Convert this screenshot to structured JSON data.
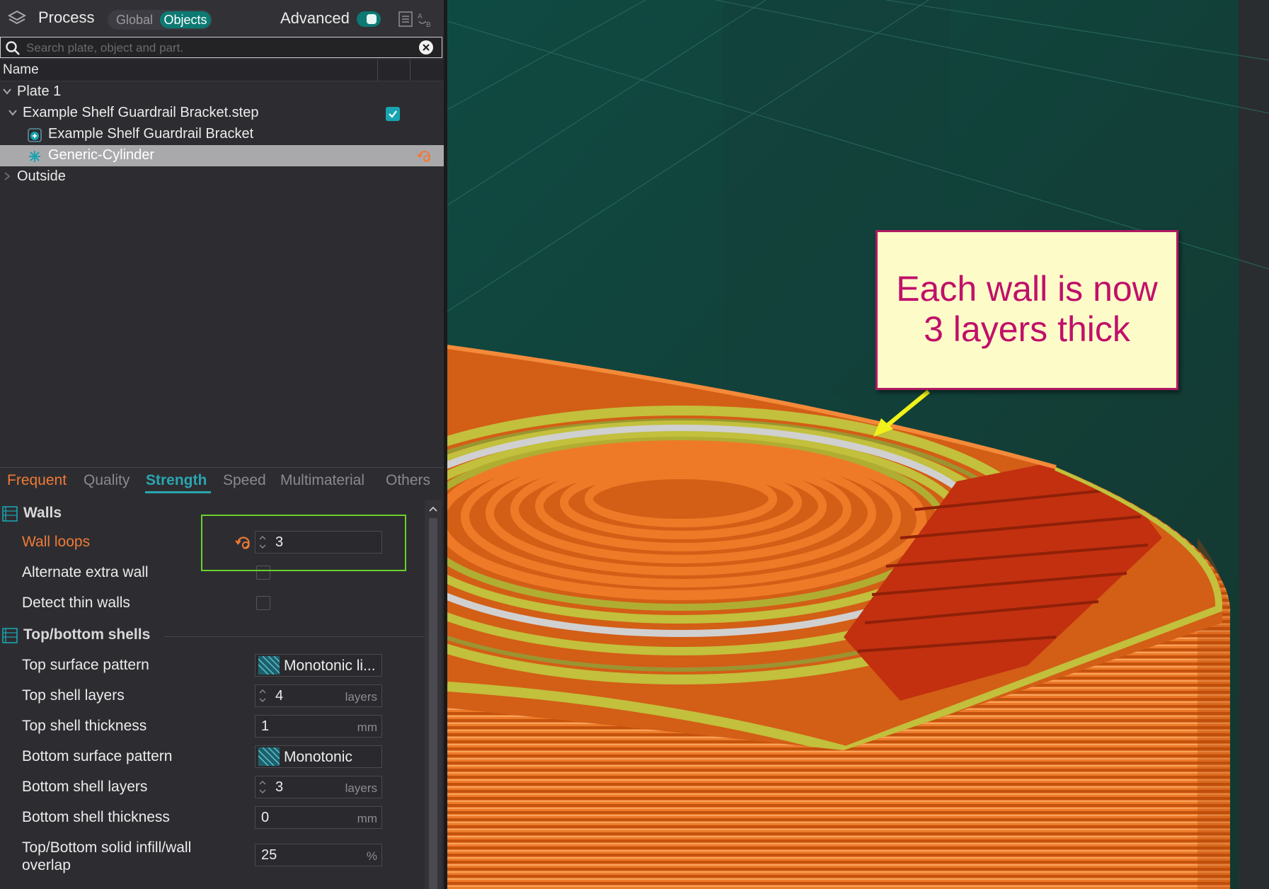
{
  "header": {
    "title": "Process",
    "mode_global": "Global",
    "mode_objects": "Objects",
    "advanced_label": "Advanced",
    "advanced_on": true
  },
  "search": {
    "placeholder": "Search plate, object and part."
  },
  "object_list": {
    "column_name": "Name",
    "items": [
      {
        "label": "Plate 1",
        "level": 0,
        "expanded": true
      },
      {
        "label": "Example Shelf Guardrail Bracket.step",
        "level": 1,
        "expanded": true,
        "checked": true
      },
      {
        "label": "Example Shelf Guardrail Bracket",
        "level": 2,
        "icon": "part-icon"
      },
      {
        "label": "Generic-Cylinder",
        "level": 2,
        "icon": "modifier-icon",
        "selected": true,
        "modified": true
      },
      {
        "label": "Outside",
        "level": 0,
        "expanded": false
      }
    ]
  },
  "tabs": [
    "Frequent",
    "Quality",
    "Strength",
    "Speed",
    "Multimaterial",
    "Others"
  ],
  "active_tab": "Strength",
  "sections": {
    "walls": {
      "title": "Walls",
      "wall_loops": {
        "label": "Wall loops",
        "value": "3",
        "modified": true
      },
      "alternate_extra_wall": {
        "label": "Alternate extra wall",
        "checked": false
      },
      "detect_thin_walls": {
        "label": "Detect thin walls",
        "checked": false
      }
    },
    "top_bottom": {
      "title": "Top/bottom shells",
      "top_surface_pattern": {
        "label": "Top surface pattern",
        "value": "Monotonic li..."
      },
      "top_shell_layers": {
        "label": "Top shell layers",
        "value": "4",
        "unit": "layers"
      },
      "top_shell_thickness": {
        "label": "Top shell thickness",
        "value": "1",
        "unit": "mm"
      },
      "bottom_surface_pattern": {
        "label": "Bottom surface pattern",
        "value": "Monotonic"
      },
      "bottom_shell_layers": {
        "label": "Bottom shell layers",
        "value": "3",
        "unit": "layers"
      },
      "bottom_shell_thickness": {
        "label": "Bottom shell thickness",
        "value": "0",
        "unit": "mm"
      },
      "overlap": {
        "label_line1": "Top/Bottom solid infill/wall",
        "label_line2": "overlap",
        "value": "25",
        "unit": "%"
      }
    }
  },
  "annotation": {
    "line1": "Each wall is now",
    "line2": "3 layers thick"
  },
  "colors": {
    "accent": "#0c7a72",
    "modified": "#ef7a36",
    "highlight_box": "#6cd02c",
    "callout_text": "#c0106a",
    "outer_wall": "#e56a1a",
    "inner_wall": "#b5b03a",
    "infill": "#c8321a"
  }
}
